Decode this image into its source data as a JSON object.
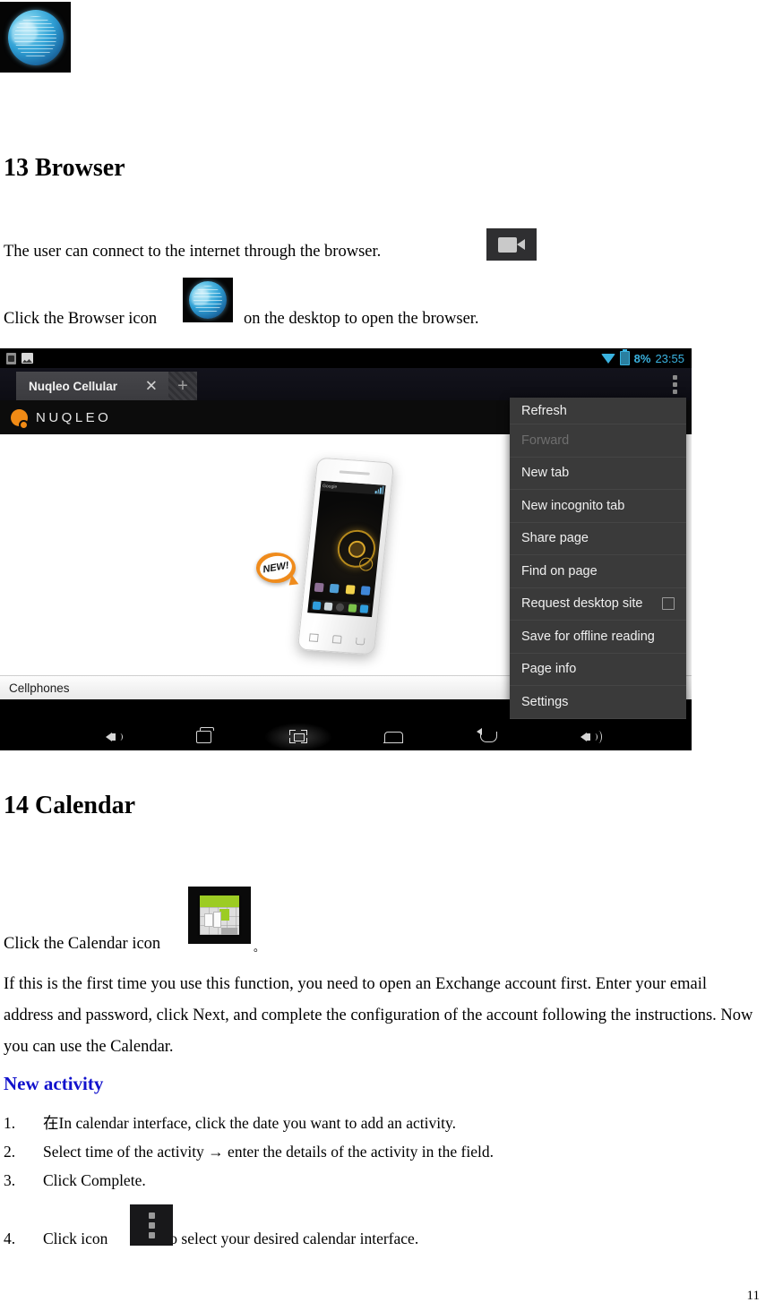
{
  "document": {
    "page_number": "11",
    "sections": [
      {
        "heading": "13 Browser",
        "paragraph_1": "The user can connect to the internet through the browser.",
        "paragraph_2_before": "Click the Browser icon",
        "paragraph_2_after": "on the desktop to open the browser."
      },
      {
        "heading": "14 Calendar",
        "calendar_click_before": "Click the Calendar icon",
        "calendar_click_after": "。",
        "body": "If this is the first time you use this function, you need to open an Exchange account first. Enter your email address and password, click Next, and complete the configuration of the account following the instructions. Now you can use the Calendar.",
        "subheading": "New activity",
        "subheading_color": "#1111cc",
        "steps": [
          {
            "num": "1.",
            "text": "在In calendar interface, click the date you want to add an activity."
          },
          {
            "num": "2.",
            "text": "Select time of the activity → enter the details of the activity in the field."
          },
          {
            "num": "3.",
            "text": "Click Complete."
          },
          {
            "num": "4.",
            "text_before": "Click icon",
            "text_after": "to select your desired calendar interface."
          }
        ]
      }
    ],
    "icons": {
      "browser_globe": "globe-icon",
      "video_camera": "video-camera-icon",
      "calendar_app": "calendar-icon",
      "overflow_dots": "overflow-menu-icon"
    }
  },
  "browser_screenshot": {
    "status_bar": {
      "usb_icon": "usb-icon",
      "image_icon": "screenshot-icon",
      "wifi_icon": "wifi-icon",
      "battery_icon": "battery-charging-icon",
      "battery_percent": "8%",
      "clock": "23:55",
      "accent_color": "#3ab3e0"
    },
    "tab_bar": {
      "tab_title": "Nuqleo Cellular",
      "close_glyph": "✕",
      "new_tab_glyph": "+",
      "overflow_icon": "overflow-menu-icon"
    },
    "brand_bar": {
      "logo_text": "NUQLEO",
      "logo_color": "#f08a15"
    },
    "page_content": {
      "badge_text": "NEW!",
      "phone_google_label": "Google",
      "footer_label": "Cellphones"
    },
    "overflow_menu": {
      "items": [
        {
          "label": "Refresh",
          "disabled": false,
          "checkbox": false
        },
        {
          "label": "Forward",
          "disabled": true,
          "checkbox": false
        },
        {
          "label": "New tab",
          "disabled": false,
          "checkbox": false
        },
        {
          "label": "New incognito tab",
          "disabled": false,
          "checkbox": false
        },
        {
          "label": "Share page",
          "disabled": false,
          "checkbox": false
        },
        {
          "label": "Find on page",
          "disabled": false,
          "checkbox": false
        },
        {
          "label": "Request desktop site",
          "disabled": false,
          "checkbox": true
        },
        {
          "label": "Save for offline reading",
          "disabled": false,
          "checkbox": false
        },
        {
          "label": "Page info",
          "disabled": false,
          "checkbox": false
        },
        {
          "label": "Settings",
          "disabled": false,
          "checkbox": false
        }
      ]
    },
    "nav_bar": {
      "buttons": [
        {
          "name": "volume-down-icon"
        },
        {
          "name": "recents-icon"
        },
        {
          "name": "screenshot-icon"
        },
        {
          "name": "home-icon"
        },
        {
          "name": "back-icon"
        },
        {
          "name": "volume-up-icon"
        }
      ]
    }
  }
}
